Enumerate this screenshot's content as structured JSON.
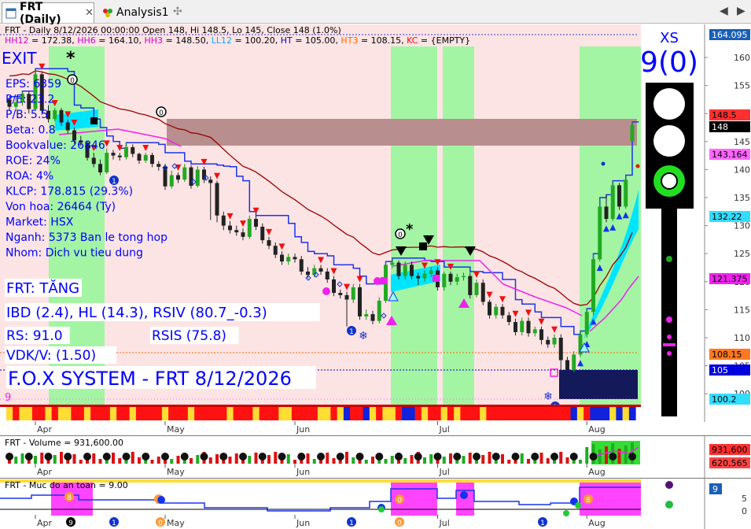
{
  "tabs": [
    {
      "label": "FRT (Daily)",
      "active": true
    },
    {
      "label": "Analysis1",
      "active": false
    }
  ],
  "header": {
    "line1": "FRT - Daily 8/12/2026 00:00:00 Open 148, Hi 148.5, Lo 145, Close 148 (1.0%)",
    "line2_parts": [
      {
        "text": "HH12",
        "color": "#cc00cc"
      },
      {
        "text": " = 172.38, ",
        "color": "#000000"
      },
      {
        "text": "HH6",
        "color": "#cc00cc"
      },
      {
        "text": " = 164.10, ",
        "color": "#000000"
      },
      {
        "text": "HH3",
        "color": "#cc00cc"
      },
      {
        "text": " = 148.50, ",
        "color": "#000000"
      },
      {
        "text": "LL12",
        "color": "#00aaff"
      },
      {
        "text": " = 100.20, ",
        "color": "#000000"
      },
      {
        "text": "HT",
        "color": "#0000cc"
      },
      {
        "text": " = 105.00, ",
        "color": "#000000"
      },
      {
        "text": "HT3",
        "color": "#ff6600"
      },
      {
        "text": " = 108.15, ",
        "color": "#000000"
      },
      {
        "text": "KC",
        "color": "#ff0000"
      },
      {
        "text": " = {EMPTY}",
        "color": "#000000"
      }
    ]
  },
  "left_panel": {
    "exit_label": "EXIT",
    "star": "*",
    "fundamentals": [
      "EPS: 6359",
      "P/E: 23.2",
      "P/B: 5.5",
      "Beta: 0.8",
      "Bookvalue: 26846",
      "ROE: 24%",
      "ROA: 4%",
      "KLCP: 178.815 (29.3%)",
      "Von hoa: 26464 (Ty)",
      "Market: HSX",
      "Nganh: 5373 Ban le tong hop",
      "Nhom: Dich vu tieu dung"
    ],
    "trend": "FRT: TĂNG",
    "ibd": "IBD (2.4), HL (14.3), RSIV (80.7_-0.3)",
    "rs": "RS: 91.0",
    "rsis": "RSIS (75.8)",
    "vdk": "VDK/V:  (1.50)",
    "brand": "F.O.X SYSTEM - FRT 8/12/2026",
    "small_nine": "9"
  },
  "signal": {
    "label": "XS",
    "value": "9(0)"
  },
  "price_axis": {
    "ticks": [
      "160",
      "155",
      "150",
      "145",
      "140",
      "135",
      "130",
      "125",
      "120",
      "115",
      "110",
      "105",
      "100"
    ],
    "badges": [
      {
        "text": "164.095",
        "bg": "#1a5fb4",
        "fg": "#ffffff"
      },
      {
        "text": "148.5",
        "bg": "#ff3030",
        "fg": "#000000"
      },
      {
        "text": "148",
        "bg": "#000000",
        "fg": "#ffffff"
      },
      {
        "text": "143.164",
        "bg": "#ff66ff",
        "fg": "#000000"
      },
      {
        "text": "132.22",
        "bg": "#33ddff",
        "fg": "#000000"
      },
      {
        "text": "121.375",
        "bg": "#ee22ee",
        "fg": "#000000"
      },
      {
        "text": "108.15",
        "bg": "#ff7722",
        "fg": "#000000"
      },
      {
        "text": "105",
        "bg": "#0000dd",
        "fg": "#ffffff"
      },
      {
        "text": "100.2",
        "bg": "#33ddff",
        "fg": "#000000"
      }
    ]
  },
  "months": [
    "Apr",
    "May",
    "Jun",
    "Jul",
    "Aug"
  ],
  "volume_pane": {
    "title": "FRT - Volume = 931,600.00",
    "badges": [
      {
        "text": "931,600",
        "bg": "#ff3030",
        "fg": "#000000"
      },
      {
        "text": "620,565",
        "bg": "#ff4444",
        "fg": "#000000"
      }
    ]
  },
  "safety_pane": {
    "title": "FRT - Muc do an toan = 9.00",
    "ticks": [
      "5",
      "0"
    ],
    "badge": {
      "text": "9",
      "bg": "#1a5fb4",
      "fg": "#ffffff"
    }
  },
  "chart_data": {
    "type": "candlestick",
    "symbol": "FRT",
    "ylim": [
      98,
      165
    ],
    "x": [
      "Mar 26",
      "Mar 27",
      "Mar 30",
      "Mar 31",
      "Apr 1",
      "Apr 2",
      "Apr 3",
      "Apr 6",
      "Apr 7",
      "Apr 8",
      "Apr 9",
      "Apr 10",
      "Apr 13",
      "Apr 14",
      "Apr 15",
      "Apr 16",
      "Apr 17",
      "Apr 20",
      "Apr 21",
      "Apr 22",
      "Apr 23",
      "Apr 24",
      "Apr 27",
      "Apr 28",
      "May 4",
      "May 5",
      "May 6",
      "May 7",
      "May 8",
      "May 11",
      "May 12",
      "May 13",
      "May 14",
      "May 15",
      "May 18",
      "May 19",
      "May 20",
      "May 21",
      "May 22",
      "May 25",
      "May 26",
      "May 27",
      "May 28",
      "May 29",
      "Jun 1",
      "Jun 2",
      "Jun 3",
      "Jun 4",
      "Jun 5",
      "Jun 8",
      "Jun 9",
      "Jun 10",
      "Jun 11",
      "Jun 12",
      "Jun 15",
      "Jun 16",
      "Jun 17",
      "Jun 18",
      "Jun 19",
      "Jun 22",
      "Jun 23",
      "Jun 24",
      "Jun 25",
      "Jun 26",
      "Jun 29",
      "Jun 30",
      "Jul 1",
      "Jul 2",
      "Jul 3",
      "Jul 6",
      "Jul 7",
      "Jul 8",
      "Jul 9",
      "Jul 10",
      "Jul 13",
      "Jul 14",
      "Jul 15",
      "Jul 16",
      "Jul 17",
      "Jul 20",
      "Jul 21",
      "Jul 22",
      "Jul 23",
      "Jul 24",
      "Jul 27",
      "Jul 28",
      "Jul 29",
      "Jul 30",
      "Jul 31",
      "Aug 3",
      "Aug 4",
      "Aug 5",
      "Aug 6",
      "Aug 7",
      "Aug 10",
      "Aug 11",
      "Aug 12"
    ],
    "close": [
      151.2,
      152.0,
      153.5,
      150.8,
      157.0,
      150.5,
      149.0,
      150.6,
      148.4,
      147.0,
      145.2,
      144.8,
      142.1,
      141.0,
      139.5,
      143.0,
      142.5,
      142.2,
      144.0,
      142.8,
      141.6,
      142.6,
      141.0,
      140.5,
      137.0,
      139.0,
      138.2,
      140.4,
      137.1,
      140.0,
      138.2,
      137.6,
      131.8,
      130.0,
      129.2,
      128.8,
      128.0,
      131.2,
      129.8,
      127.4,
      126.4,
      124.8,
      123.6,
      124.4,
      124.0,
      121.8,
      121.2,
      122.4,
      121.8,
      120.4,
      118.0,
      117.6,
      116.8,
      119.0,
      113.8,
      114.2,
      113.0,
      116.6,
      123.0,
      123.4,
      121.0,
      123.0,
      121.0,
      120.6,
      121.4,
      122.0,
      119.0,
      121.4,
      120.0,
      120.8,
      121.0,
      117.6,
      119.8,
      116.4,
      114.0,
      115.5,
      114.0,
      112.8,
      111.0,
      113.0,
      110.8,
      111.5,
      109.6,
      108.8,
      110.0,
      106.0,
      104.2,
      107.0,
      110.6,
      114.6,
      124.0,
      133.4,
      131.2,
      137.2,
      133.4,
      138.2,
      148.0
    ],
    "open": [
      152.5,
      151.2,
      152.0,
      153.5,
      150.8,
      157.0,
      150.5,
      149.0,
      150.6,
      148.4,
      147.0,
      145.2,
      144.8,
      142.1,
      141.0,
      139.5,
      143.0,
      142.5,
      142.2,
      144.0,
      142.8,
      141.6,
      142.6,
      141.0,
      140.5,
      137.0,
      139.0,
      138.2,
      140.4,
      137.1,
      140.0,
      138.2,
      137.6,
      131.8,
      130.0,
      129.2,
      128.8,
      128.0,
      131.2,
      129.8,
      127.4,
      126.4,
      124.8,
      123.6,
      124.4,
      124.0,
      121.8,
      121.2,
      122.4,
      121.8,
      120.4,
      118.0,
      117.6,
      116.8,
      119.0,
      113.8,
      114.2,
      113.0,
      116.6,
      123.0,
      123.4,
      121.0,
      123.0,
      121.0,
      120.6,
      121.4,
      122.0,
      119.0,
      121.4,
      120.0,
      120.8,
      121.0,
      117.6,
      119.8,
      116.4,
      114.0,
      115.5,
      114.0,
      112.8,
      111.0,
      113.0,
      110.8,
      111.5,
      109.6,
      108.8,
      110.0,
      106.0,
      104.2,
      107.0,
      110.6,
      114.6,
      124.0,
      133.4,
      131.2,
      137.2,
      133.4,
      145.0
    ],
    "high": [
      153.0,
      152.8,
      154.0,
      154.0,
      158.0,
      157.5,
      151.5,
      151.0,
      151.0,
      149.0,
      147.5,
      146.0,
      145.0,
      143.0,
      141.8,
      143.8,
      143.5,
      143.0,
      144.8,
      144.5,
      143.0,
      143.0,
      143.0,
      141.5,
      141.0,
      139.8,
      139.5,
      141.0,
      140.8,
      140.6,
      140.5,
      138.8,
      138.0,
      132.5,
      130.8,
      130.0,
      129.5,
      131.8,
      131.8,
      130.4,
      128.0,
      127.0,
      125.4,
      125.0,
      125.0,
      124.6,
      122.6,
      123.0,
      123.0,
      122.4,
      121.0,
      118.6,
      118.2,
      119.6,
      119.6,
      115.0,
      114.8,
      117.2,
      123.6,
      124.2,
      123.8,
      123.6,
      123.6,
      121.6,
      122.0,
      122.6,
      122.6,
      121.8,
      121.8,
      121.4,
      121.6,
      121.6,
      120.4,
      120.4,
      116.8,
      116.0,
      116.0,
      114.6,
      113.4,
      113.6,
      113.6,
      112.0,
      112.0,
      110.2,
      110.6,
      110.6,
      106.6,
      107.6,
      111.2,
      115.2,
      125.0,
      135.0,
      135.5,
      138.0,
      137.6,
      139.0,
      148.5
    ],
    "low": [
      150.5,
      150.5,
      151.4,
      150.0,
      150.5,
      149.8,
      148.4,
      148.6,
      147.8,
      146.4,
      144.6,
      144.2,
      141.6,
      140.4,
      139.0,
      139.2,
      141.8,
      141.6,
      141.8,
      142.2,
      141.0,
      141.2,
      140.4,
      139.8,
      136.4,
      136.6,
      137.6,
      137.8,
      136.6,
      136.8,
      137.6,
      131.0,
      130.6,
      129.2,
      128.6,
      128.2,
      127.4,
      127.6,
      129.2,
      126.8,
      125.8,
      124.2,
      123.0,
      123.0,
      123.4,
      121.2,
      120.6,
      120.8,
      121.2,
      119.8,
      117.4,
      117.0,
      112.0,
      116.2,
      113.2,
      113.2,
      112.4,
      112.6,
      116.2,
      122.4,
      120.4,
      120.4,
      120.4,
      119.4,
      120.0,
      120.8,
      118.4,
      118.4,
      119.4,
      119.4,
      120.2,
      117.0,
      117.2,
      115.8,
      113.4,
      113.4,
      113.4,
      112.2,
      110.4,
      110.4,
      110.2,
      110.2,
      108.8,
      108.2,
      108.2,
      104.0,
      103.6,
      103.8,
      106.6,
      110.0,
      114.0,
      123.6,
      130.6,
      130.8,
      132.8,
      133.0,
      145.0
    ],
    "overlay_lines": [
      {
        "name": "HH12",
        "color": "#cc00cc",
        "value": 172.38
      },
      {
        "name": "HH6",
        "color": "#cc00cc",
        "value": 164.1
      },
      {
        "name": "HH3",
        "color": "#cc00cc",
        "value": 148.5
      },
      {
        "name": "LL12",
        "color": "#00aaff",
        "value": 100.2
      },
      {
        "name": "HT",
        "color": "#0000cc",
        "value": 105.0
      },
      {
        "name": "HT3",
        "color": "#ff6600",
        "value": 108.15
      }
    ],
    "months": [
      {
        "label": "Apr",
        "index": 4
      },
      {
        "label": "May",
        "index": 24
      },
      {
        "label": "Jun",
        "index": 44
      },
      {
        "label": "Jul",
        "index": 66
      },
      {
        "label": "Aug",
        "index": 89
      }
    ],
    "volume_last": 931600,
    "volume_avg": 620565,
    "safety_last": 9
  }
}
